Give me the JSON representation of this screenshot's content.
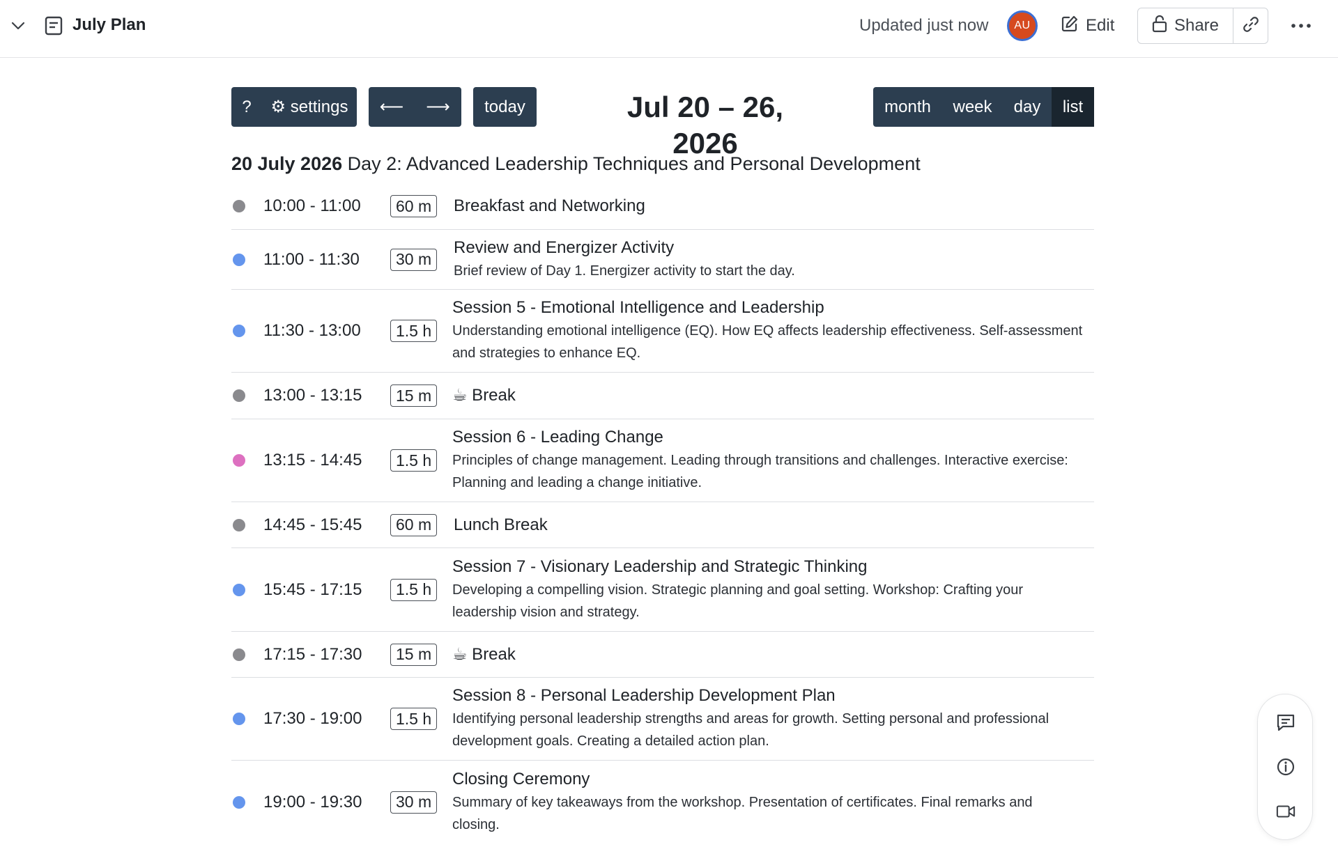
{
  "header": {
    "title": "July Plan",
    "updated": "Updated just now",
    "avatar_initials": "AU",
    "edit_label": "Edit",
    "share_label": "Share"
  },
  "toolbar": {
    "help_label": "?",
    "settings_label": "⚙ settings",
    "prev_label": "⟵",
    "next_label": "⟶",
    "today_label": "today",
    "range_title": "Jul 20 – 26, 2026",
    "views": [
      "month",
      "week",
      "day",
      "list"
    ],
    "active_view": "list"
  },
  "day": {
    "date": "20 July 2026",
    "title": "Day 2: Advanced Leadership Techniques and Personal Development"
  },
  "colors": {
    "gray": "#8a8a8e",
    "blue": "#6495ed",
    "pink": "#dd70c0",
    "toolbar": "#2c3e50"
  },
  "events": [
    {
      "time": "10:00 - 11:00",
      "duration": "60 m",
      "title": "Breakfast and Networking",
      "desc": "",
      "color": "#8a8a8e"
    },
    {
      "time": "11:00 - 11:30",
      "duration": "30 m",
      "title": "Review and Energizer Activity",
      "desc": "Brief review of Day 1. Energizer activity to start the day.",
      "color": "#6495ed"
    },
    {
      "time": "11:30 - 13:00",
      "duration": "1.5 h",
      "title": "Session 5 - Emotional Intelligence and Leadership",
      "desc": "Understanding emotional intelligence (EQ). How EQ affects leadership effectiveness. Self-assessment and strategies to enhance EQ.",
      "color": "#6495ed"
    },
    {
      "time": "13:00 - 13:15",
      "duration": "15 m",
      "title": "☕ Break",
      "desc": "",
      "color": "#8a8a8e"
    },
    {
      "time": "13:15 - 14:45",
      "duration": "1.5 h",
      "title": "Session 6 - Leading Change",
      "desc": "Principles of change management. Leading through transitions and challenges. Interactive exercise: Planning and leading a change initiative.",
      "color": "#dd70c0"
    },
    {
      "time": "14:45 - 15:45",
      "duration": "60 m",
      "title": "Lunch Break",
      "desc": "",
      "color": "#8a8a8e"
    },
    {
      "time": "15:45 - 17:15",
      "duration": "1.5 h",
      "title": "Session 7 - Visionary Leadership and Strategic Thinking",
      "desc": "Developing a compelling vision. Strategic planning and goal setting. Workshop: Crafting your leadership vision and strategy.",
      "color": "#6495ed"
    },
    {
      "time": "17:15 - 17:30",
      "duration": "15 m",
      "title": "☕ Break",
      "desc": "",
      "color": "#8a8a8e"
    },
    {
      "time": "17:30 - 19:00",
      "duration": "1.5 h",
      "title": "Session 8 - Personal Leadership Development Plan",
      "desc": "Identifying personal leadership strengths and areas for growth. Setting personal and professional development goals. Creating a detailed action plan.",
      "color": "#6495ed"
    },
    {
      "time": "19:00 - 19:30",
      "duration": "30 m",
      "title": "Closing Ceremony",
      "desc": "Summary of key takeaways from the workshop. Presentation of certificates. Final remarks and closing.",
      "color": "#6495ed"
    }
  ],
  "side_panel": [
    "comment-icon",
    "info-icon",
    "video-icon"
  ]
}
